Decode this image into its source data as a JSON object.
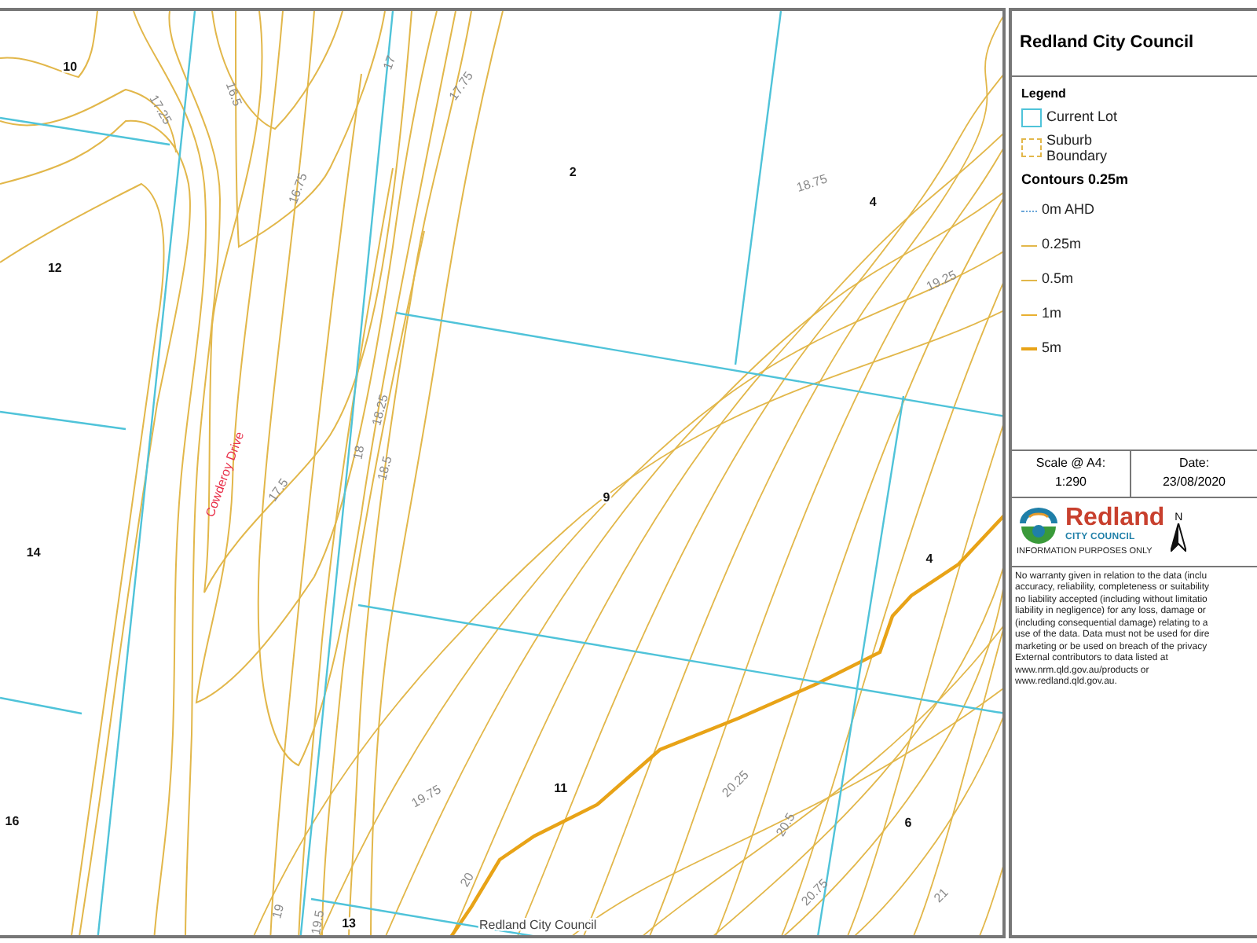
{
  "map": {
    "lot_numbers": [
      "10",
      "12",
      "14",
      "16",
      "2",
      "4",
      "9",
      "4",
      "11",
      "6",
      "13"
    ],
    "contour_labels": [
      "17.25",
      "16.5",
      "16.75",
      "17",
      "17.75",
      "17.5",
      "18",
      "18.25",
      "18.5",
      "18.75",
      "19.25",
      "19.75",
      "20",
      "19",
      "19.5",
      "20.25",
      "20.5",
      "20.75",
      "21"
    ],
    "road_name": "Cowderoy Drive",
    "attribution": "Redland City Council"
  },
  "panel": {
    "title": "Redland City Council",
    "legend": {
      "heading": "Legend",
      "items": [
        {
          "kind": "lot",
          "label": "Current Lot"
        },
        {
          "kind": "suburb",
          "label": "Suburb Boundary"
        }
      ],
      "contours_heading": "Contours 0.25m",
      "contour_items": [
        {
          "kind": "dotted",
          "label": "0m AHD"
        },
        {
          "kind": "thin",
          "label": "0.25m"
        },
        {
          "kind": "thin",
          "label": "0.5m"
        },
        {
          "kind": "medium",
          "label": "1m"
        },
        {
          "kind": "thick",
          "label": "5m"
        }
      ]
    },
    "scale": {
      "label": "Scale @ A4:",
      "value": "1:290"
    },
    "date": {
      "label": "Date:",
      "value": "23/08/2020"
    },
    "logo": {
      "name": "Redland",
      "subtitle": "CITY COUNCIL",
      "tagline": "INFORMATION PURPOSES ONLY"
    },
    "north": "N",
    "disclaimer": [
      "No warranty given in relation to the data (inclu",
      "accuracy, reliability, completeness or suitability",
      "no liability accepted (including without limitatio",
      "liability in negligence) for any loss, damage or",
      "(including consequential damage) relating to a",
      "use of the data. Data must not be used for dire",
      "marketing or be used on breach of the privacy",
      "External contributors to data listed at",
      "www.nrm.qld.gov.au/products or",
      "www.redland.qld.gov.au."
    ]
  }
}
